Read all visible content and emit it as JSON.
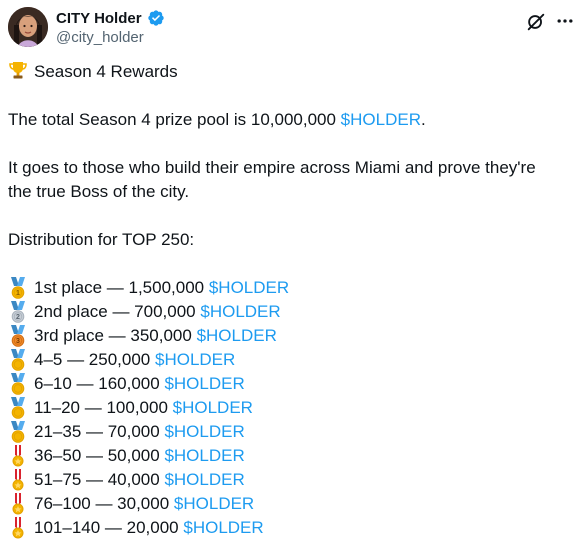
{
  "post": {
    "author": {
      "display_name": "CITY Holder",
      "handle": "@city_holder"
    },
    "title": "Season 4 Rewards",
    "para1_text": "The total Season 4 prize pool is 10,000,000 ",
    "para1_cashtag": "$HOLDER",
    "para1_end": ".",
    "para2_line1": "It goes to those who build their empire across Miami and prove they're",
    "para2_line2": "the true Boss of the city.",
    "distribution_heading": "Distribution for TOP 250:",
    "cashtag": "$HOLDER",
    "rows": [
      {
        "text": "1st place — 1,500,000 ",
        "medal": "gold-1"
      },
      {
        "text": "2nd place — 700,000 ",
        "medal": "silver-2"
      },
      {
        "text": "3rd place — 350,000 ",
        "medal": "bronze-3"
      },
      {
        "text": "4–5 — 250,000 ",
        "medal": "sports"
      },
      {
        "text": "6–10 — 160,000 ",
        "medal": "sports"
      },
      {
        "text": "11–20 — 100,000 ",
        "medal": "sports"
      },
      {
        "text": "21–35 — 70,000 ",
        "medal": "sports"
      },
      {
        "text": "36–50 — 50,000 ",
        "medal": "military"
      },
      {
        "text": "51–75 — 40,000 ",
        "medal": "military"
      },
      {
        "text": "76–100 — 30,000 ",
        "medal": "military"
      },
      {
        "text": "101–140 — 20,000 ",
        "medal": "military"
      }
    ]
  },
  "colors": {
    "accent": "#1d9bf0",
    "text": "#0f1419",
    "muted": "#536471"
  }
}
